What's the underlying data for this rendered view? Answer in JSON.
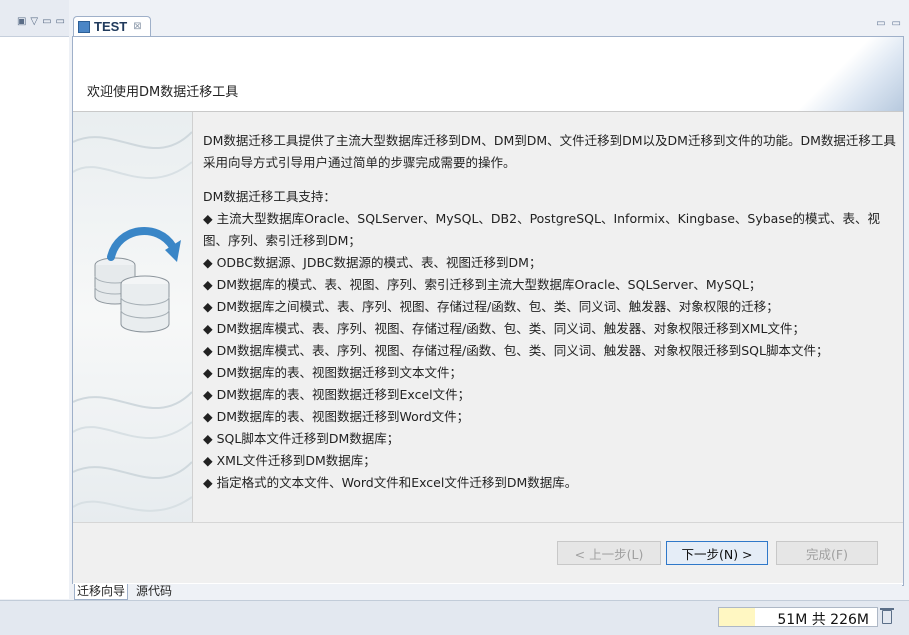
{
  "editor": {
    "tab_title": "TEST",
    "tab_close": "⊠",
    "tools": [
      "▭",
      "▭"
    ]
  },
  "left_view": {
    "tools": [
      "▣",
      "▽",
      "▭",
      "▭"
    ]
  },
  "page": {
    "header_title": "欢迎使用DM数据迁移工具",
    "intro_paragraph": "DM数据迁移工具提供了主流大型数据库迁移到DM、DM到DM、文件迁移到DM以及DM迁移到文件的功能。DM数据迁移工具采用向导方式引导用户通过简单的步骤完成需要的操作。",
    "support_title": "DM数据迁移工具支持：",
    "bullets": [
      "◆ 主流大型数据库Oracle、SQLServer、MySQL、DB2、PostgreSQL、Informix、Kingbase、Sybase的模式、表、视图、序列、索引迁移到DM；",
      "◆ ODBC数据源、JDBC数据源的模式、表、视图迁移到DM；",
      "◆ DM数据库的模式、表、视图、序列、索引迁移到主流大型数据库Oracle、SQLServer、MySQL；",
      "◆ DM数据库之间模式、表、序列、视图、存储过程/函数、包、类、同义词、触发器、对象权限的迁移；",
      "◆ DM数据库模式、表、序列、视图、存储过程/函数、包、类、同义词、触发器、对象权限迁移到XML文件；",
      "◆ DM数据库模式、表、序列、视图、存储过程/函数、包、类、同义词、触发器、对象权限迁移到SQL脚本文件；",
      "◆ DM数据库的表、视图数据迁移到文本文件；",
      "◆ DM数据库的表、视图数据迁移到Excel文件；",
      "◆ DM数据库的表、视图数据迁移到Word文件；",
      "◆ SQL脚本文件迁移到DM数据库；",
      "◆ XML文件迁移到DM数据库；",
      "◆ 指定格式的文本文件、Word文件和Excel文件迁移到DM数据库。"
    ]
  },
  "buttons": {
    "back": "< 上一步(L)",
    "next": "下一步(N) >",
    "finish": "完成(F)"
  },
  "bottom_tabs": [
    "迁移向导",
    "源代码"
  ],
  "status": {
    "heap_text": "51M 共 226M",
    "heap_used_fraction": 0.2257
  },
  "colors": {
    "accent": "#2f78c9",
    "heap_fill": "#fff7c2"
  }
}
